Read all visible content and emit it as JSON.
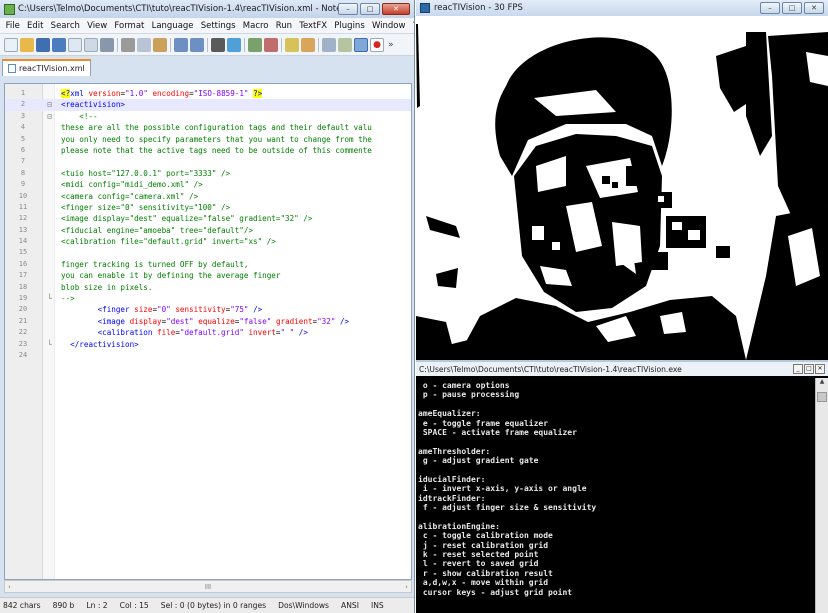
{
  "npp": {
    "title": "C:\\Users\\Telmo\\Documents\\CTI\\tuto\\reacTIVision-1.4\\reacTIVision.xml - Notepad++",
    "menu": [
      "File",
      "Edit",
      "Search",
      "View",
      "Format",
      "Language",
      "Settings",
      "Macro",
      "Run",
      "TextFX",
      "Plugins",
      "Window",
      "?",
      "X"
    ],
    "tab_label": "reacTIVision.xml",
    "toolbar_more": "»",
    "window_buttons": {
      "minimize": "–",
      "maximize": "□",
      "close": "✕"
    },
    "scroll_thumb": "III",
    "scroll_left": "‹",
    "scroll_right": "›",
    "status": {
      "chars": "842 chars",
      "bytes_lines": "890 b",
      "ln": "Ln : 2",
      "col": "Col : 15",
      "sel": "Sel : 0 (0 bytes) in 0 ranges",
      "eol": "Dos\\Windows",
      "enc": "ANSI",
      "mode": "INS"
    },
    "lines": [
      {
        "n": "1",
        "fold": "",
        "parts": [
          {
            "c": "c-tag c-hl",
            "t": "<?"
          },
          {
            "c": "c-tag",
            "t": "xml "
          },
          {
            "c": "c-att",
            "t": "version"
          },
          {
            "c": "",
            "t": "="
          },
          {
            "c": "c-val",
            "t": "\"1.0\""
          },
          {
            "c": "",
            "t": " "
          },
          {
            "c": "c-att",
            "t": "encoding"
          },
          {
            "c": "",
            "t": "="
          },
          {
            "c": "c-val",
            "t": "\"ISO-8859-1\""
          },
          {
            "c": "",
            "t": " "
          },
          {
            "c": "c-tag c-hl",
            "t": "?>"
          }
        ]
      },
      {
        "n": "2",
        "fold": "⊟",
        "parts": [
          {
            "c": "c-tag",
            "t": "<reactivision>"
          }
        ]
      },
      {
        "n": "3",
        "fold": "⊟",
        "parts": [
          {
            "c": "c-com",
            "t": "    <!--"
          }
        ]
      },
      {
        "n": "4",
        "fold": "",
        "parts": [
          {
            "c": "c-com",
            "t": "these are all the possible configuration tags and their default valu"
          }
        ]
      },
      {
        "n": "5",
        "fold": "",
        "parts": [
          {
            "c": "c-com",
            "t": "you only need to specify parameters that you want to change from the"
          }
        ]
      },
      {
        "n": "6",
        "fold": "",
        "parts": [
          {
            "c": "c-com",
            "t": "please note that the active tags need to be outside of this commente"
          }
        ]
      },
      {
        "n": "7",
        "fold": "",
        "parts": [
          {
            "c": "c-com",
            "t": ""
          }
        ]
      },
      {
        "n": "8",
        "fold": "",
        "parts": [
          {
            "c": "c-com",
            "t": "<tuio host=\"127.0.0.1\" port=\"3333\" />"
          }
        ]
      },
      {
        "n": "9",
        "fold": "",
        "parts": [
          {
            "c": "c-com",
            "t": "<midi config=\"midi_demo.xml\" />"
          }
        ]
      },
      {
        "n": "10",
        "fold": "",
        "parts": [
          {
            "c": "c-com",
            "t": "<camera config=\"camera.xml\" />"
          }
        ]
      },
      {
        "n": "11",
        "fold": "",
        "parts": [
          {
            "c": "c-com",
            "t": "<finger size=\"0\" sensitivity=\"100\" />"
          }
        ]
      },
      {
        "n": "12",
        "fold": "",
        "parts": [
          {
            "c": "c-com",
            "t": "<image display=\"dest\" equalize=\"false\" gradient=\"32\" />"
          }
        ]
      },
      {
        "n": "13",
        "fold": "",
        "parts": [
          {
            "c": "c-com",
            "t": "<fiducial engine=\"amoeba\" tree=\"default\"/>"
          }
        ]
      },
      {
        "n": "14",
        "fold": "",
        "parts": [
          {
            "c": "c-com",
            "t": "<calibration file=\"default.grid\" invert=\"xs\" />"
          }
        ]
      },
      {
        "n": "15",
        "fold": "",
        "parts": [
          {
            "c": "c-com",
            "t": ""
          }
        ]
      },
      {
        "n": "16",
        "fold": "",
        "parts": [
          {
            "c": "c-com",
            "t": "finger tracking is turned OFF by default,"
          }
        ]
      },
      {
        "n": "17",
        "fold": "",
        "parts": [
          {
            "c": "c-com",
            "t": "you can enable it by defining the average finger"
          }
        ]
      },
      {
        "n": "18",
        "fold": "",
        "parts": [
          {
            "c": "c-com",
            "t": "blob size in pixels."
          }
        ]
      },
      {
        "n": "19",
        "fold": "└",
        "parts": [
          {
            "c": "c-com",
            "t": "-->"
          }
        ]
      },
      {
        "n": "20",
        "fold": "",
        "parts": [
          {
            "c": "",
            "t": "        "
          },
          {
            "c": "c-tag",
            "t": "<finger "
          },
          {
            "c": "c-att",
            "t": "size"
          },
          {
            "c": "",
            "t": "="
          },
          {
            "c": "c-val",
            "t": "\"0\""
          },
          {
            "c": "",
            "t": " "
          },
          {
            "c": "c-att",
            "t": "sensitivity"
          },
          {
            "c": "",
            "t": "="
          },
          {
            "c": "c-val",
            "t": "\"75\""
          },
          {
            "c": "",
            "t": " "
          },
          {
            "c": "c-tag",
            "t": "/>"
          }
        ]
      },
      {
        "n": "21",
        "fold": "",
        "parts": [
          {
            "c": "",
            "t": "        "
          },
          {
            "c": "c-tag",
            "t": "<image "
          },
          {
            "c": "c-att",
            "t": "display"
          },
          {
            "c": "",
            "t": "="
          },
          {
            "c": "c-val",
            "t": "\"dest\""
          },
          {
            "c": "",
            "t": " "
          },
          {
            "c": "c-att",
            "t": "equalize"
          },
          {
            "c": "",
            "t": "="
          },
          {
            "c": "c-val",
            "t": "\"false\""
          },
          {
            "c": "",
            "t": " "
          },
          {
            "c": "c-att",
            "t": "gradient"
          },
          {
            "c": "",
            "t": "="
          },
          {
            "c": "c-val",
            "t": "\"32\""
          },
          {
            "c": "",
            "t": " "
          },
          {
            "c": "c-tag",
            "t": "/>"
          }
        ]
      },
      {
        "n": "22",
        "fold": "",
        "parts": [
          {
            "c": "",
            "t": "        "
          },
          {
            "c": "c-tag",
            "t": "<calibration "
          },
          {
            "c": "c-att",
            "t": "file"
          },
          {
            "c": "",
            "t": "="
          },
          {
            "c": "c-val",
            "t": "\"default.grid\""
          },
          {
            "c": "",
            "t": " "
          },
          {
            "c": "c-att",
            "t": "invert"
          },
          {
            "c": "",
            "t": "="
          },
          {
            "c": "c-val",
            "t": "\" \""
          },
          {
            "c": "",
            "t": " "
          },
          {
            "c": "c-tag",
            "t": "/>"
          }
        ]
      },
      {
        "n": "23",
        "fold": "└",
        "parts": [
          {
            "c": "",
            "t": "  "
          },
          {
            "c": "c-tag",
            "t": "</reactivision>"
          }
        ]
      },
      {
        "n": "24",
        "fold": "",
        "parts": []
      }
    ]
  },
  "viewer": {
    "title": "reacTIVision - 30 FPS",
    "window_buttons": {
      "minimize": "–",
      "maximize": "□",
      "close": "✕"
    }
  },
  "console": {
    "title": "C:\\Users\\Telmo\\Documents\\CTI\\tuto\\reacTIVision-1.4\\reacTIVision.exe",
    "window_buttons": {
      "minimize": "_",
      "maximize": "□",
      "close": "✕"
    },
    "scroll_up": "▲",
    "lines": [
      " o - camera options",
      " p - pause processing",
      "",
      "ameEqualizer:",
      " e - toggle frame equalizer",
      " SPACE - activate frame equalizer",
      "",
      "ameThresholder:",
      " g - adjust gradient gate",
      "",
      "iducialFinder:",
      " i - invert x-axis, y-axis or angle",
      "idtrackFinder:",
      " f - adjust finger size & sensitivity",
      "",
      "alibrationEngine:",
      " c - toggle calibration mode",
      " j - reset calibration grid",
      " k - reset selected point",
      " l - revert to saved grid",
      " r - show calibration result",
      " a,d,w,x - move within grid",
      " cursor keys - adjust grid point"
    ]
  },
  "colors": {
    "npp_frame": "#d6e2f0",
    "current_line": "#e8e8ff",
    "tag": "#0000ff",
    "attribute": "#ff0000",
    "value": "#8000ff",
    "comment": "#008000",
    "console_bg": "#000000",
    "console_fg": "#e8e8e8"
  },
  "toolbar_icons": [
    "new-file-icon",
    "open-file-icon",
    "save-icon",
    "save-all-icon",
    "close-file-icon",
    "close-all-icon",
    "print-icon",
    "cut-icon",
    "copy-icon",
    "paste-icon",
    "undo-icon",
    "redo-icon",
    "find-icon",
    "replace-icon",
    "zoom-in-icon",
    "zoom-out-icon",
    "sync-v-icon",
    "sync-h-icon",
    "wrap-icon",
    "all-chars-icon",
    "indent-guide-icon",
    "macro-record-icon"
  ]
}
